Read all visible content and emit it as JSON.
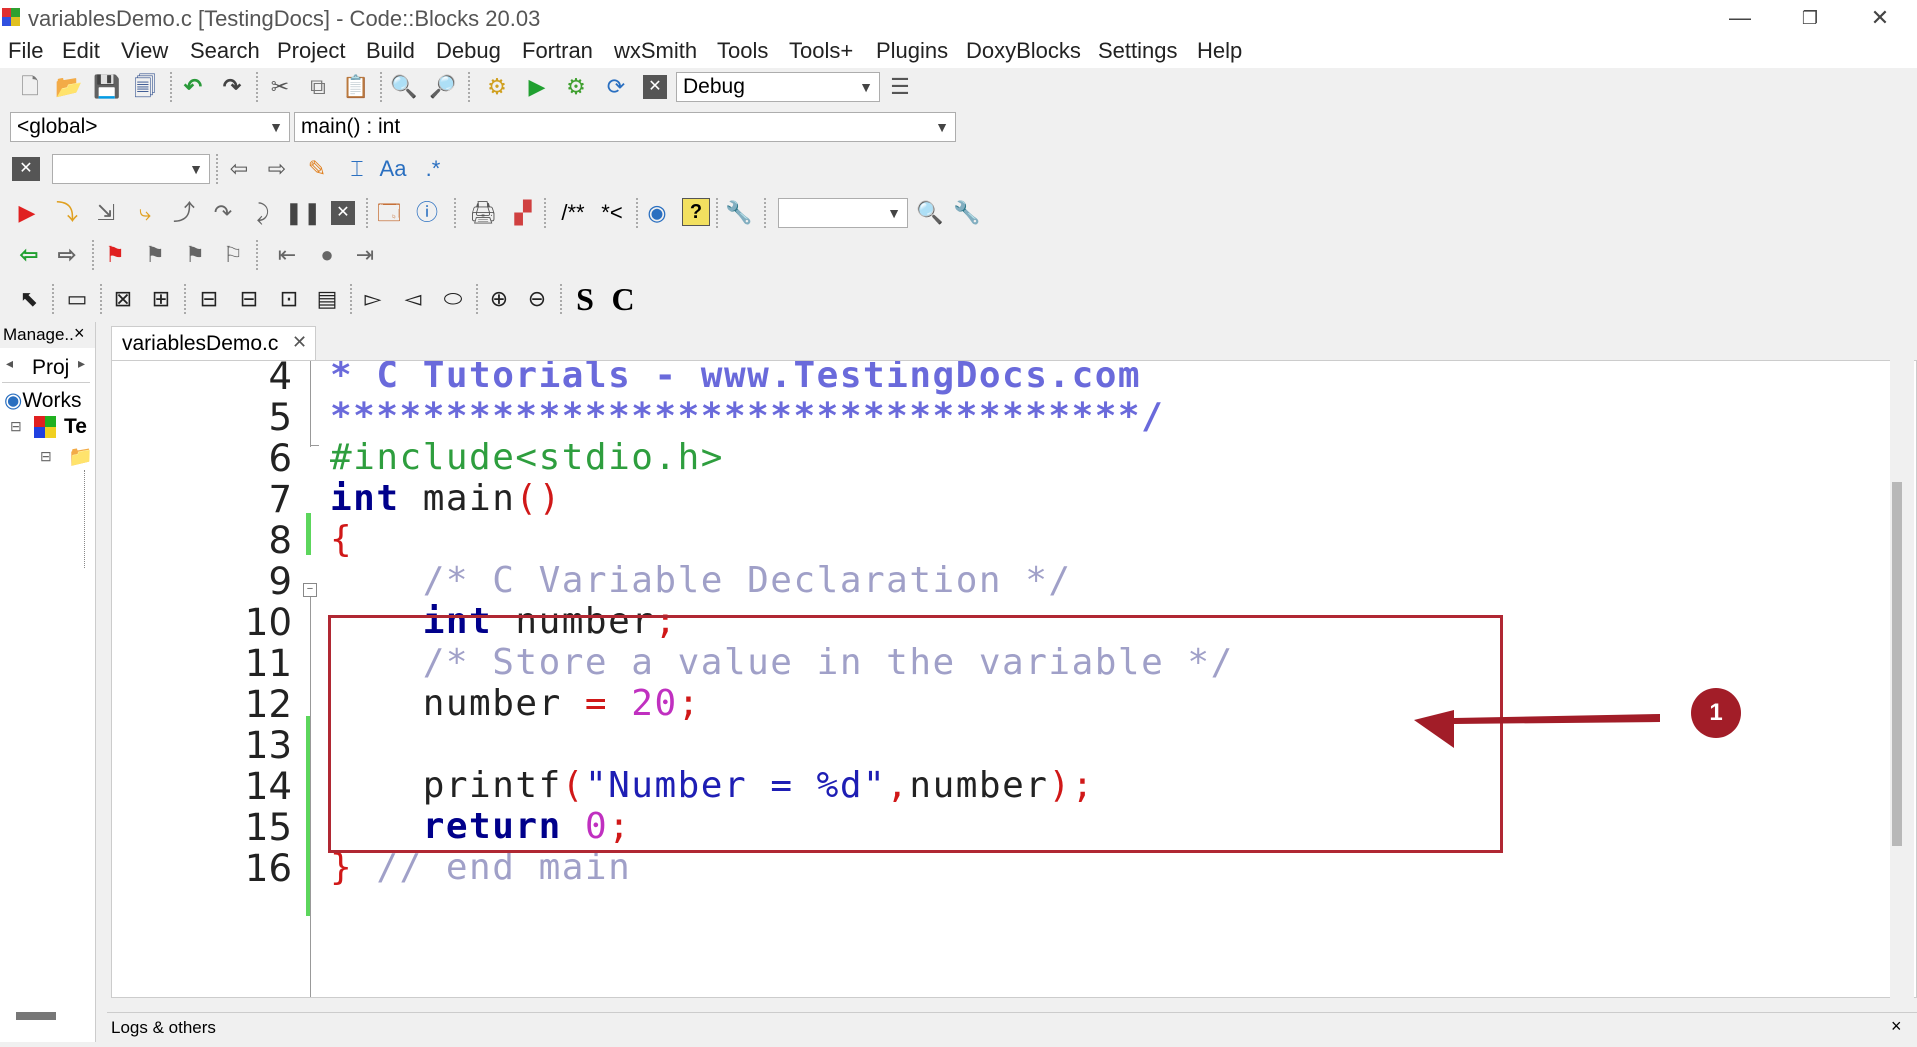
{
  "window": {
    "title": "variablesDemo.c [TestingDocs] - Code::Blocks 20.03",
    "minimize_glyph": "—",
    "restore_glyph": "❐",
    "close_glyph": "✕"
  },
  "menu": [
    "File",
    "Edit",
    "View",
    "Search",
    "Project",
    "Build",
    "Debug",
    "Fortran",
    "wxSmith",
    "Tools",
    "Tools+",
    "Plugins",
    "DoxyBlocks",
    "Settings",
    "Help"
  ],
  "toolbar": {
    "build_target": "Debug",
    "scope": "<global>",
    "function": "main() : int",
    "regex_label": ".*",
    "doc_comment_label": "/**",
    "comment_label": "*<",
    "s_label": "S",
    "c_label": "C",
    "aa_label": "Aa"
  },
  "management": {
    "title": "Manage..",
    "close": "×",
    "tab_label": "Proj",
    "workspace_label": "Works",
    "project_label": "Te"
  },
  "editor": {
    "tab_label": "variablesDemo.c",
    "tab_close": "✕",
    "lines": [
      {
        "number": "4",
        "text": "* C Tutorials - www.TestingDocs.com"
      },
      {
        "number": "5",
        "text": "***********************************/"
      },
      {
        "number": "6",
        "text": "#include<stdio.h>"
      },
      {
        "number": "7",
        "text": "int main()"
      },
      {
        "number": "8",
        "text": "{"
      },
      {
        "number": "9",
        "text": "    /* C Variable Declaration */"
      },
      {
        "number": "10",
        "text": "    int number;"
      },
      {
        "number": "11",
        "text": "    /* Store a value in the variable */"
      },
      {
        "number": "12",
        "text": "    number = 20;"
      },
      {
        "number": "13",
        "text": ""
      },
      {
        "number": "14",
        "text": "    printf(\"Number = %d\",number);"
      },
      {
        "number": "15",
        "text": "    return 0;"
      },
      {
        "number": "16",
        "text": "} // end main"
      }
    ]
  },
  "annotation": {
    "badge": "1"
  },
  "logs": {
    "label": "Logs & others",
    "close": "×"
  },
  "colors": {
    "keyword": "#00008b",
    "comment": "#a0a0c8",
    "preprocessor": "#2e9e3e",
    "string": "#1e1eb4",
    "number": "#c030c0",
    "annotation": "#b02833"
  }
}
